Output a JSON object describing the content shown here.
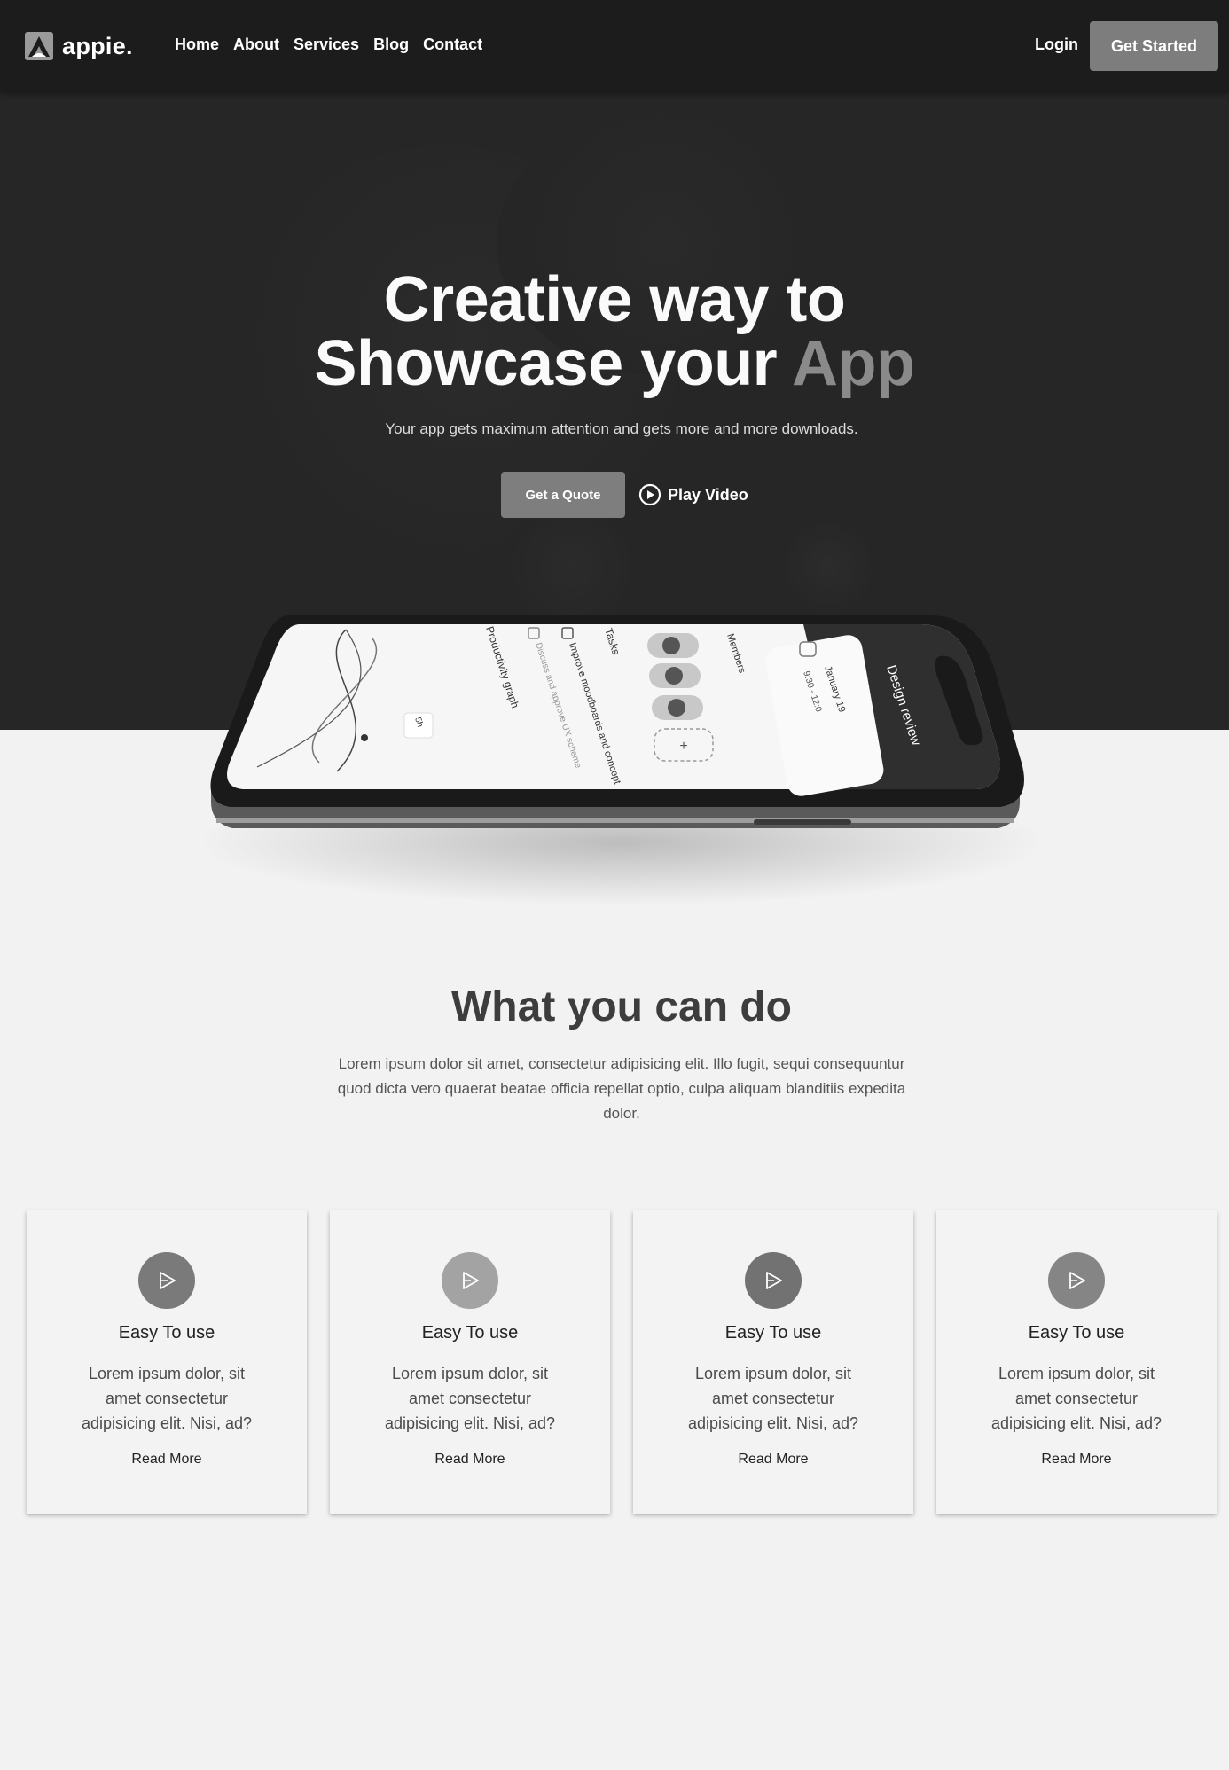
{
  "brand": {
    "name": "appie.",
    "logo_icon": "appie-logo-icon"
  },
  "nav": {
    "links": [
      "Home",
      "About",
      "Services",
      "Blog",
      "Contact"
    ],
    "login": "Login",
    "cta": "Get Started"
  },
  "hero": {
    "title_line1": "Creative way to",
    "title_line2_start": "Showcase your ",
    "title_accent": "App",
    "subtitle": "Your app gets maximum attention and gets more and more downloads.",
    "quote_button": "Get a Quote",
    "video_button": "Play Video",
    "video_icon": "play-circle-icon"
  },
  "phone_screen": {
    "graph_title": "Productivity graph",
    "graph_badge": "5h",
    "tasks_title": "Tasks",
    "task_1": "Improve moodboards and concept",
    "task_2": "Discuss and approve UX scheme",
    "members_title": "Members",
    "card_title": "Design review",
    "card_date": "January 19",
    "card_time": "9:30 - 12:0"
  },
  "section": {
    "title": "What you can do",
    "text": "Lorem ipsum dolor sit amet, consectetur adipisicing elit. Illo fugit, sequi consequuntur quod dicta vero quaerat beatae officia repellat optio, culpa aliquam blanditiis expedita dolor."
  },
  "features": [
    {
      "title": "Easy To use",
      "text": "Lorem ipsum dolor, sit amet consectetur adipisicing elit. Nisi, ad?",
      "link": "Read More",
      "icon": "play-icon",
      "icon_color": "#7a7a7a"
    },
    {
      "title": "Easy To use",
      "text": "Lorem ipsum dolor, sit amet consectetur adipisicing elit. Nisi, ad?",
      "link": "Read More",
      "icon": "play-icon",
      "icon_color": "#a3a3a3"
    },
    {
      "title": "Easy To use",
      "text": "Lorem ipsum dolor, sit amet consectetur adipisicing elit. Nisi, ad?",
      "link": "Read More",
      "icon": "play-icon",
      "icon_color": "#727272"
    },
    {
      "title": "Easy To use",
      "text": "Lorem ipsum dolor, sit amet consectetur adipisicing elit. Nisi, ad?",
      "link": "Read More",
      "icon": "play-icon",
      "icon_color": "#858585"
    }
  ],
  "colors": {
    "navbar": "#1c1c1c",
    "hero": "#262626",
    "accent": "#8a8a8a",
    "page": "#f2f2f2"
  }
}
